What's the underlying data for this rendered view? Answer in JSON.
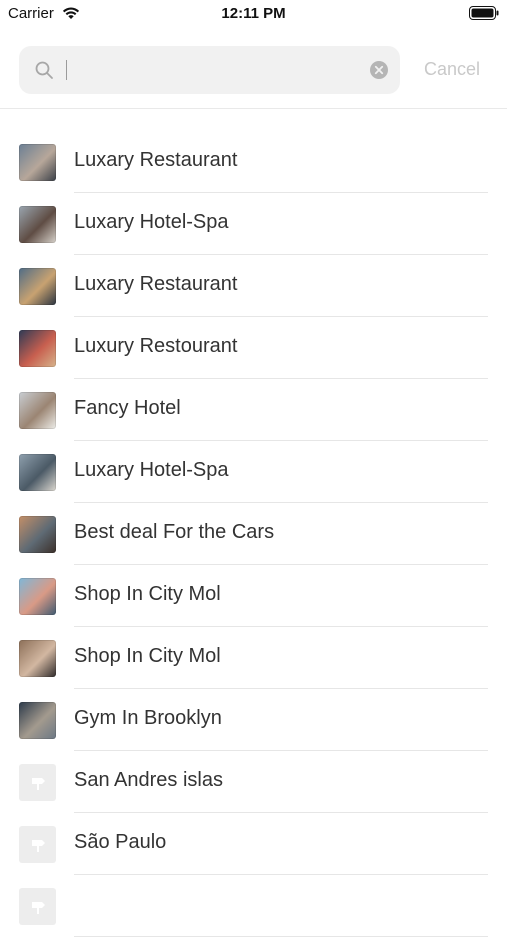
{
  "status_bar": {
    "carrier": "Carrier",
    "time": "12:11 PM"
  },
  "search": {
    "value": "",
    "placeholder": "",
    "cancel_label": "Cancel"
  },
  "results": [
    {
      "label": "Luxary Restaurant",
      "thumb": "photo",
      "colors": [
        "#6b7f94",
        "#b7a79a",
        "#3a3f47"
      ]
    },
    {
      "label": "Luxary Hotel-Spa",
      "thumb": "photo",
      "colors": [
        "#9aa6b0",
        "#5f4d44",
        "#d7d2cb"
      ]
    },
    {
      "label": "Luxary Restaurant",
      "thumb": "photo",
      "colors": [
        "#4f6c86",
        "#c8a271",
        "#2b3440"
      ]
    },
    {
      "label": "Luxury Restourant",
      "thumb": "photo",
      "colors": [
        "#2e3a55",
        "#c85f4f",
        "#d6b48c"
      ]
    },
    {
      "label": "Fancy Hotel",
      "thumb": "photo",
      "colors": [
        "#c9ced3",
        "#9b8573",
        "#eeeeea"
      ]
    },
    {
      "label": "Luxary Hotel-Spa",
      "thumb": "photo",
      "colors": [
        "#8fa0ae",
        "#4b5a66",
        "#dcd8d0"
      ]
    },
    {
      "label": "Best deal For the Cars",
      "thumb": "photo",
      "colors": [
        "#c48f68",
        "#5e6a74",
        "#3b2f29"
      ]
    },
    {
      "label": "Shop In City Mol",
      "thumb": "photo",
      "colors": [
        "#7fb7d8",
        "#d99a86",
        "#3f5a71"
      ]
    },
    {
      "label": "Shop In City Mol",
      "thumb": "photo",
      "colors": [
        "#8c6f58",
        "#d2b7a1",
        "#2f2b2b"
      ]
    },
    {
      "label": "Gym In Brooklyn",
      "thumb": "photo",
      "colors": [
        "#2c3a4a",
        "#a39a8e",
        "#6b7784"
      ]
    },
    {
      "label": "San Andres islas",
      "thumb": "placeholder",
      "colors": [
        "#ededed"
      ]
    },
    {
      "label": "São Paulo",
      "thumb": "placeholder",
      "colors": [
        "#ededed"
      ]
    },
    {
      "label": "",
      "thumb": "placeholder",
      "colors": [
        "#ededed"
      ]
    }
  ]
}
